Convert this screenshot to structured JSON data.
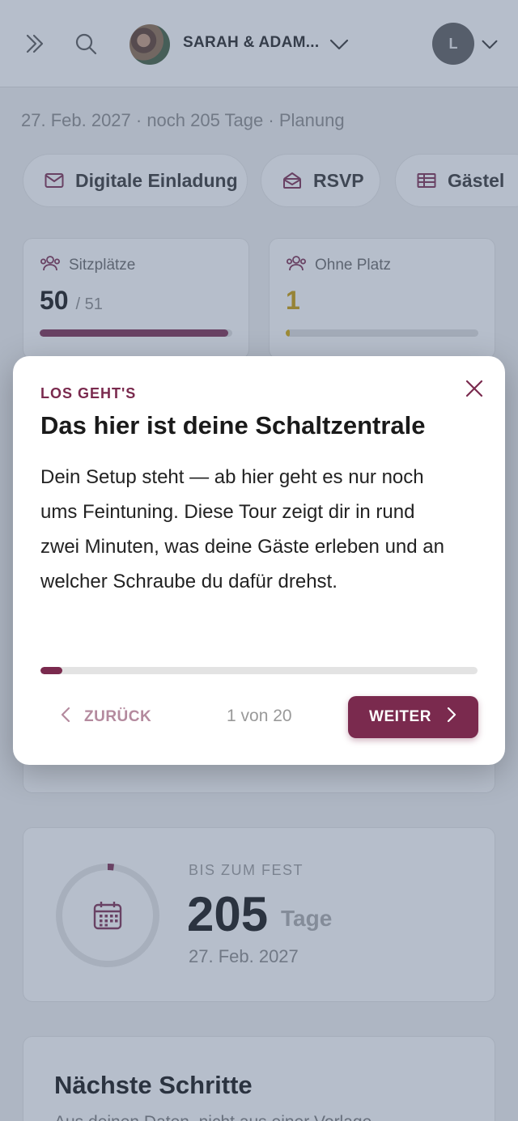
{
  "header": {
    "couple_name": "SARAH & ADAM...",
    "user_initial": "L",
    "icons": [
      "chevrons-right-icon",
      "search-icon",
      "chevron-down-icon",
      "chevron-down-icon"
    ]
  },
  "event": {
    "meta": "27. Feb. 2027 · noch 205 Tage · Planung"
  },
  "quick_links": [
    {
      "label": "Digitale Einladung",
      "icon": "mail-icon"
    },
    {
      "label": "RSVP",
      "icon": "open-envelope-icon"
    },
    {
      "label": "Gästel",
      "icon": "table-icon"
    }
  ],
  "stats": [
    {
      "label": "Sitzplätze",
      "value": "50",
      "total": "/ 51",
      "progress": 0.98,
      "color": "#7a2a4e"
    },
    {
      "label": "Ohne Platz",
      "value": "1",
      "total": "",
      "progress": 0.02,
      "color": "#d4a800"
    }
  ],
  "countdown": {
    "eyebrow": "BIS ZUM FEST",
    "days": "205",
    "unit": "Tage",
    "date": "27. Feb. 2027",
    "progress": 0.02
  },
  "next_steps": {
    "title": "Nächste Schritte",
    "subtitle": "Aus deinen Daten, nicht aus einer Vorlage"
  },
  "tour": {
    "eyebrow": "LOS GEHT'S",
    "title": "Das hier ist deine Schaltzentrale",
    "body": "Dein Setup steht — ab hier geht es nur noch ums Feintuning. Diese Tour zeigt dir in rund zwei Minuten, was deine Gäste erleben und an welcher Schraube du dafür drehst.",
    "progress": 0.05,
    "back_label": "ZURÜCK",
    "counter": "1 von 20",
    "next_label": "WEITER"
  },
  "colors": {
    "accent": "#7a2a4e",
    "warning": "#d4a800"
  }
}
